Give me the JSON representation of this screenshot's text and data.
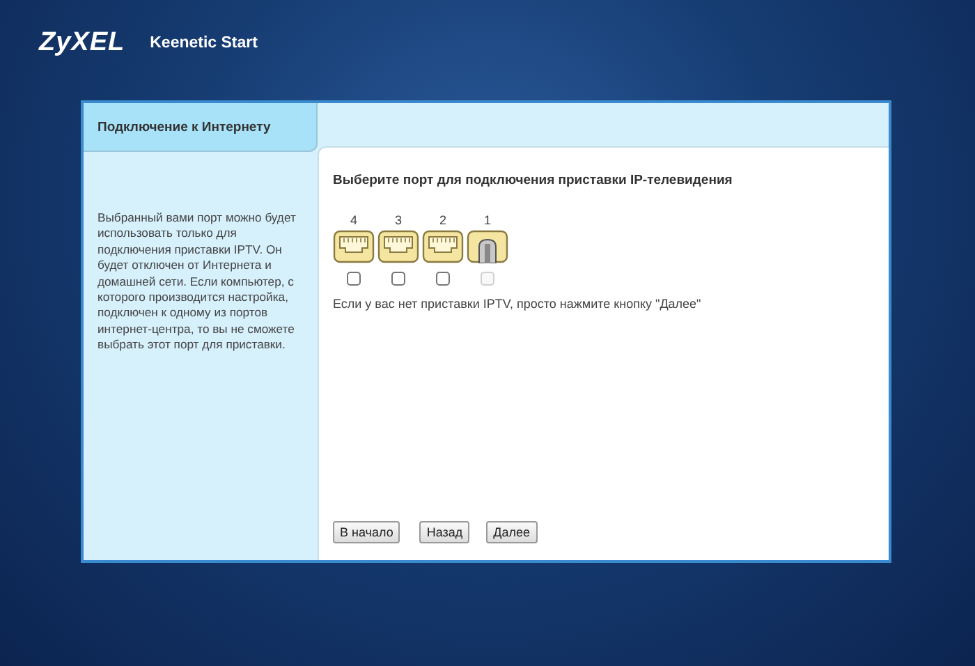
{
  "header": {
    "logo": "ZyXEL",
    "product": "Keenetic Start"
  },
  "sidebar": {
    "title": "Подключение к Интернету",
    "description": "Выбранный вами порт можно будет использовать только для подключения приставки IPTV. Он будет отключен от Интернета и домашней сети. Если компьютер, с которого производится настройка, подключен к одному из портов интернет-центра, то вы не сможете выбрать этот порт для приставки."
  },
  "content": {
    "heading": "Выберите порт для подключения приставки IP-телевидения",
    "ports": [
      {
        "label": "4",
        "connected": false,
        "checked": false,
        "disabled": false
      },
      {
        "label": "3",
        "connected": false,
        "checked": false,
        "disabled": false
      },
      {
        "label": "2",
        "connected": false,
        "checked": false,
        "disabled": false
      },
      {
        "label": "1",
        "connected": true,
        "checked": false,
        "disabled": true
      }
    ],
    "hint": "Если у вас нет приставки IPTV, просто нажмите кнопку \"Далее\"",
    "buttons": [
      "В начало",
      "Назад",
      "Далее"
    ]
  }
}
